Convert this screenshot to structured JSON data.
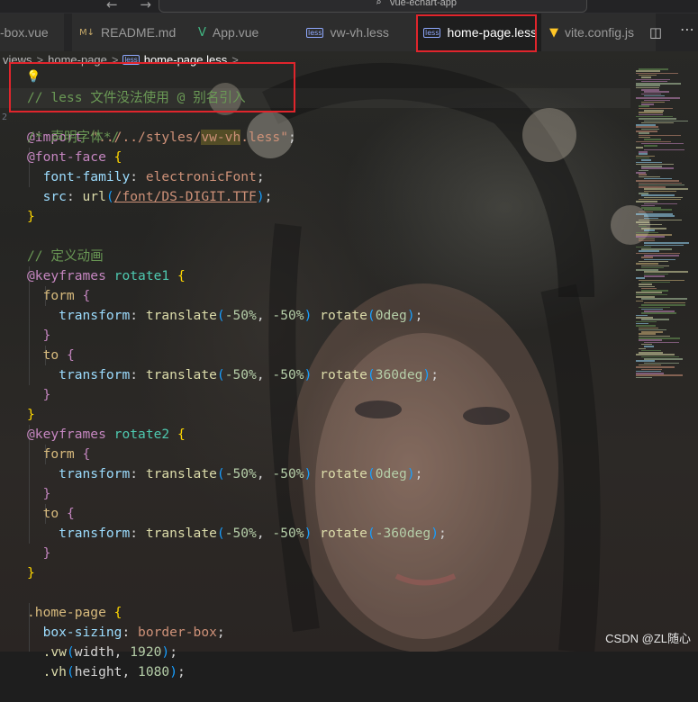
{
  "titlebar": {
    "nav_arrows": "←  →",
    "search_icon": "⌕",
    "command_center_text": "vue-echart-app"
  },
  "tabs": [
    {
      "label": "-box.vue",
      "icon": "vue",
      "active": false
    },
    {
      "label": "README.md",
      "icon": "md",
      "active": false
    },
    {
      "label": "App.vue",
      "icon": "vue",
      "active": false
    },
    {
      "label": "vw-vh.less",
      "icon": "less",
      "active": false
    },
    {
      "label": "home-page.less",
      "icon": "less",
      "active": true,
      "close": "✕"
    },
    {
      "label": "vite.config.js",
      "icon": "vite",
      "active": false
    }
  ],
  "tab_icons": {
    "less": "less",
    "md": "M↓",
    "vue": "V",
    "vite": "▼"
  },
  "tab_actions": {
    "split": "◫",
    "more": "⋯"
  },
  "breadcrumb": {
    "items": [
      "views",
      "home-page",
      "home-page.less",
      "..."
    ],
    "separator": ">",
    "file_icon": "less"
  },
  "editor": {
    "line_number_visible": "2",
    "bulb_icon": "💡",
    "lines": [
      "// less 文件没法使用 @ 别名引入",
      "@import \"../../styles/vw-vh.less\";",
      "/* 声明字体*/",
      "@font-face {",
      "  font-family: electronicFont;",
      "  src: url(/font/DS-DIGIT.TTF);",
      "}",
      "",
      "// 定义动画",
      "@keyframes rotate1 {",
      "  form {",
      "    transform: translate(-50%, -50%) rotate(0deg);",
      "  }",
      "  to {",
      "    transform: translate(-50%, -50%) rotate(360deg);",
      "  }",
      "}",
      "@keyframes rotate2 {",
      "  form {",
      "    transform: translate(-50%, -50%) rotate(0deg);",
      "  }",
      "  to {",
      "    transform: translate(-50%, -50%) rotate(-360deg);",
      "  }",
      "}",
      "",
      ".home-page {",
      "  box-sizing: border-box;",
      "  .vw(width, 1920);",
      "  .vh(height, 1080);"
    ]
  },
  "colors": {
    "annotation_red": "#e0252c",
    "comment": "#6a9955",
    "at_rule": "#c586c0",
    "string": "#ce9178",
    "property": "#9cdcfe",
    "function": "#dcdcaa",
    "number": "#b5cea8"
  },
  "watermark": "CSDN @ZL随心"
}
